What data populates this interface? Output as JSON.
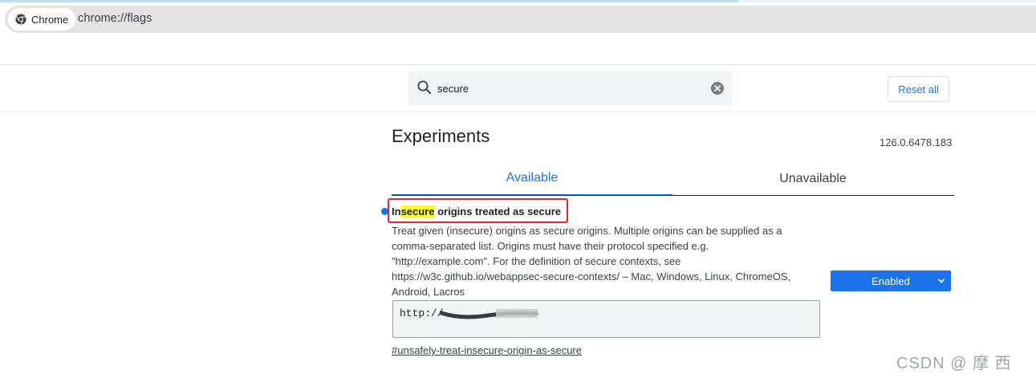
{
  "browser": {
    "chip_label": "Chrome",
    "url": "chrome://flags"
  },
  "header": {
    "search_value": "secure",
    "reset_label": "Reset all"
  },
  "main": {
    "title": "Experiments",
    "version": "126.0.6478.183",
    "tabs": [
      {
        "label": "Available",
        "selected": true
      },
      {
        "label": "Unavailable",
        "selected": false
      }
    ]
  },
  "flag": {
    "title_prefix": "In",
    "title_match": "secure",
    "title_suffix": " origins treated as secure",
    "description_lines": [
      "Treat given (insecure) origins as secure origins. Multiple origins can be supplied as a",
      "comma-separated list. Origins must have their protocol specified e.g.",
      "\"http://example.com\". For the definition of secure contexts, see",
      "https://w3c.github.io/webappsec-secure-contexts/ – Mac, Windows, Linux, ChromeOS,",
      "Android, Lacros"
    ],
    "textarea_value": "http://",
    "select_value": "Enabled",
    "link": "#unsafely-treat-insecure-origin-as-secure"
  },
  "watermark": "CSDN @ 摩 西",
  "colors": {
    "accent": "#1a73e8",
    "highlight": "#ffff33",
    "annotation_red": "#e0282e"
  },
  "icons": {
    "chrome": "chrome-logo-icon",
    "search": "search-icon",
    "clear": "clear-circle-x-icon",
    "chevron": "chevron-down-icon"
  }
}
